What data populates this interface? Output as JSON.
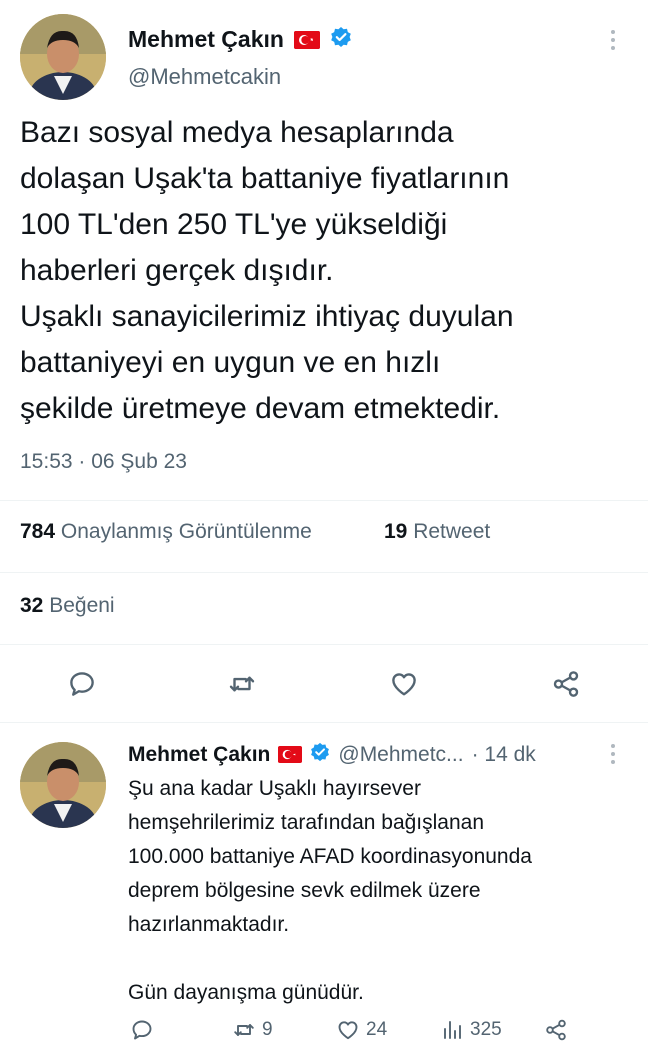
{
  "main_tweet": {
    "author_name": "Mehmet Çakın",
    "author_handle": "@Mehmetcakin",
    "text_lines": [
      "Bazı sosyal medya hesaplarında",
      "dolaşan Uşak'ta battaniye fiyatlarının",
      "100 TL'den 250 TL'ye yükseldiği",
      "haberleri gerçek dışıdır.",
      "Uşaklı sanayicilerimiz ihtiyaç duyulan",
      "battaniyeyi en uygun ve en hızlı",
      "şekilde üretmeye devam etmektedir."
    ],
    "timestamp": "15:53 · 06 Şub 23",
    "views_count": "784",
    "views_label": "Onaylanmış Görüntülenme",
    "retweets_count": "19",
    "retweets_label": "Retweet",
    "likes_count": "32",
    "likes_label": "Beğeni"
  },
  "reply_tweet": {
    "author_name": "Mehmet Çakın",
    "author_handle": "@Mehmetc...",
    "time_ago": "· 14 dk",
    "text_lines": [
      "Şu ana kadar Uşaklı hayırsever",
      "hemşehrilerimiz tarafından bağışlanan",
      "100.000 battaniye AFAD koordinasyonunda",
      "deprem bölgesine sevk edilmek üzere",
      "hazırlanmaktadır.",
      "",
      "Gün dayanışma günüdür."
    ],
    "retweets": "9",
    "likes": "24",
    "views": "325"
  },
  "colors": {
    "verified_blue": "#1d9bf0",
    "flag_red": "#e30a17",
    "muted_text": "#536471",
    "primary_text": "#0f1419"
  },
  "icons": [
    "avatar",
    "turkey-flag-icon",
    "verified-badge-icon",
    "more-icon",
    "reply-icon",
    "retweet-icon",
    "like-icon",
    "share-icon",
    "views-icon"
  ]
}
